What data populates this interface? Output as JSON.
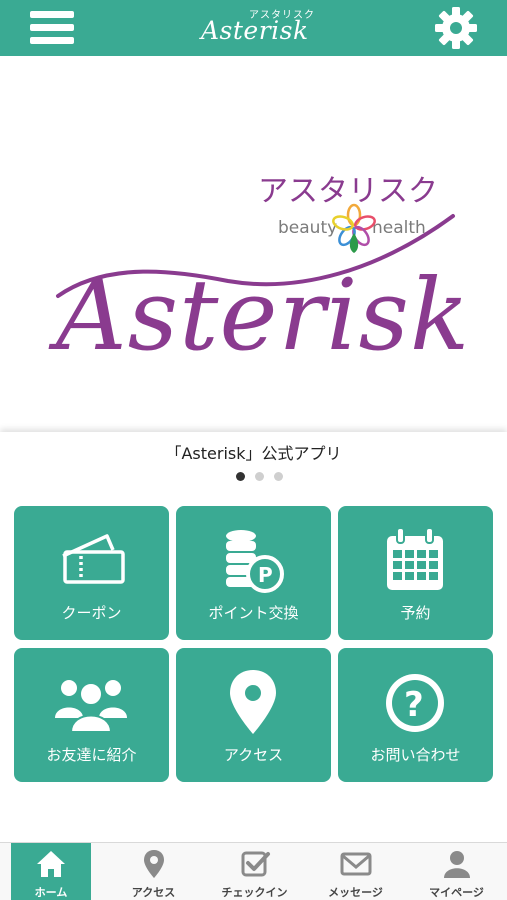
{
  "header": {
    "logo_script": "Asterisk",
    "logo_kana": "アスタリスク",
    "menu_icon": "hamburger-icon",
    "settings_icon": "gear-icon"
  },
  "hero": {
    "logo_kana": "アスタリスク",
    "logo_script": "Asterisk",
    "logo_left": "beauty",
    "logo_right": "health"
  },
  "subtitle": "「Asterisk」公式アプリ",
  "carousel": {
    "count": 3,
    "active": 0
  },
  "tiles": [
    {
      "label": "クーポン",
      "icon": "ticket-icon"
    },
    {
      "label": "ポイント交換",
      "icon": "coins-icon"
    },
    {
      "label": "予約",
      "icon": "calendar-icon"
    },
    {
      "label": "お友達に紹介",
      "icon": "users-icon"
    },
    {
      "label": "アクセス",
      "icon": "location-pin-icon"
    },
    {
      "label": "お問い合わせ",
      "icon": "question-icon"
    }
  ],
  "bottom_nav": [
    {
      "label": "ホーム",
      "icon": "home-icon",
      "active": true
    },
    {
      "label": "アクセス",
      "icon": "location-pin-icon",
      "active": false
    },
    {
      "label": "チェックイン",
      "icon": "checkin-icon",
      "active": false
    },
    {
      "label": "メッセージ",
      "icon": "mail-icon",
      "active": false
    },
    {
      "label": "マイページ",
      "icon": "user-icon",
      "active": false
    }
  ],
  "colors": {
    "brand": "#3aaa93",
    "logo_purple": "#8a3b8f"
  }
}
